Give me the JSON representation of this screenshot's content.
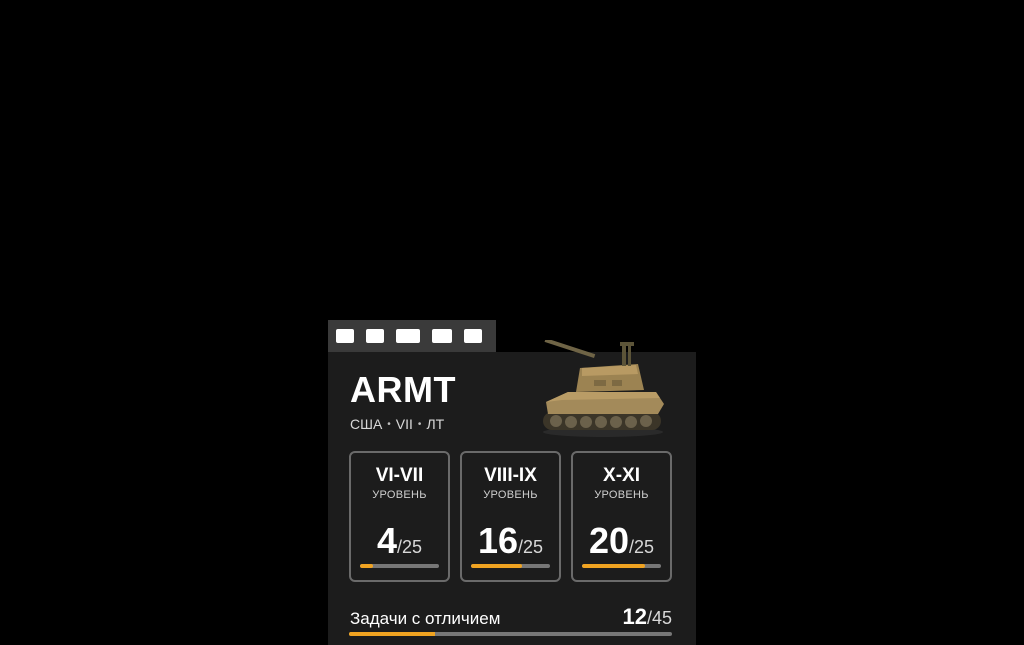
{
  "tank": {
    "name": "ARMT",
    "nation": "США",
    "tier": "VII",
    "class": "ЛТ",
    "separator": "•",
    "image_icon": "tank-icon"
  },
  "tiers": [
    {
      "range": "VI-VII",
      "sub": "УРОВЕНЬ",
      "done": "4",
      "total": "/25",
      "progress": 0.16
    },
    {
      "range": "VIII-IX",
      "sub": "УРОВЕНЬ",
      "done": "16",
      "total": "/25",
      "progress": 0.64
    },
    {
      "range": "X-XI",
      "sub": "УРОВЕНЬ",
      "done": "20",
      "total": "/25",
      "progress": 0.8
    }
  ],
  "distinction": {
    "label": "Задачи с отличием",
    "done": "12",
    "total": "/45",
    "progress": 0.267
  },
  "colors": {
    "accent": "#f0a321",
    "card_bg": "#1c1c1c",
    "border": "#6a6a6a"
  }
}
